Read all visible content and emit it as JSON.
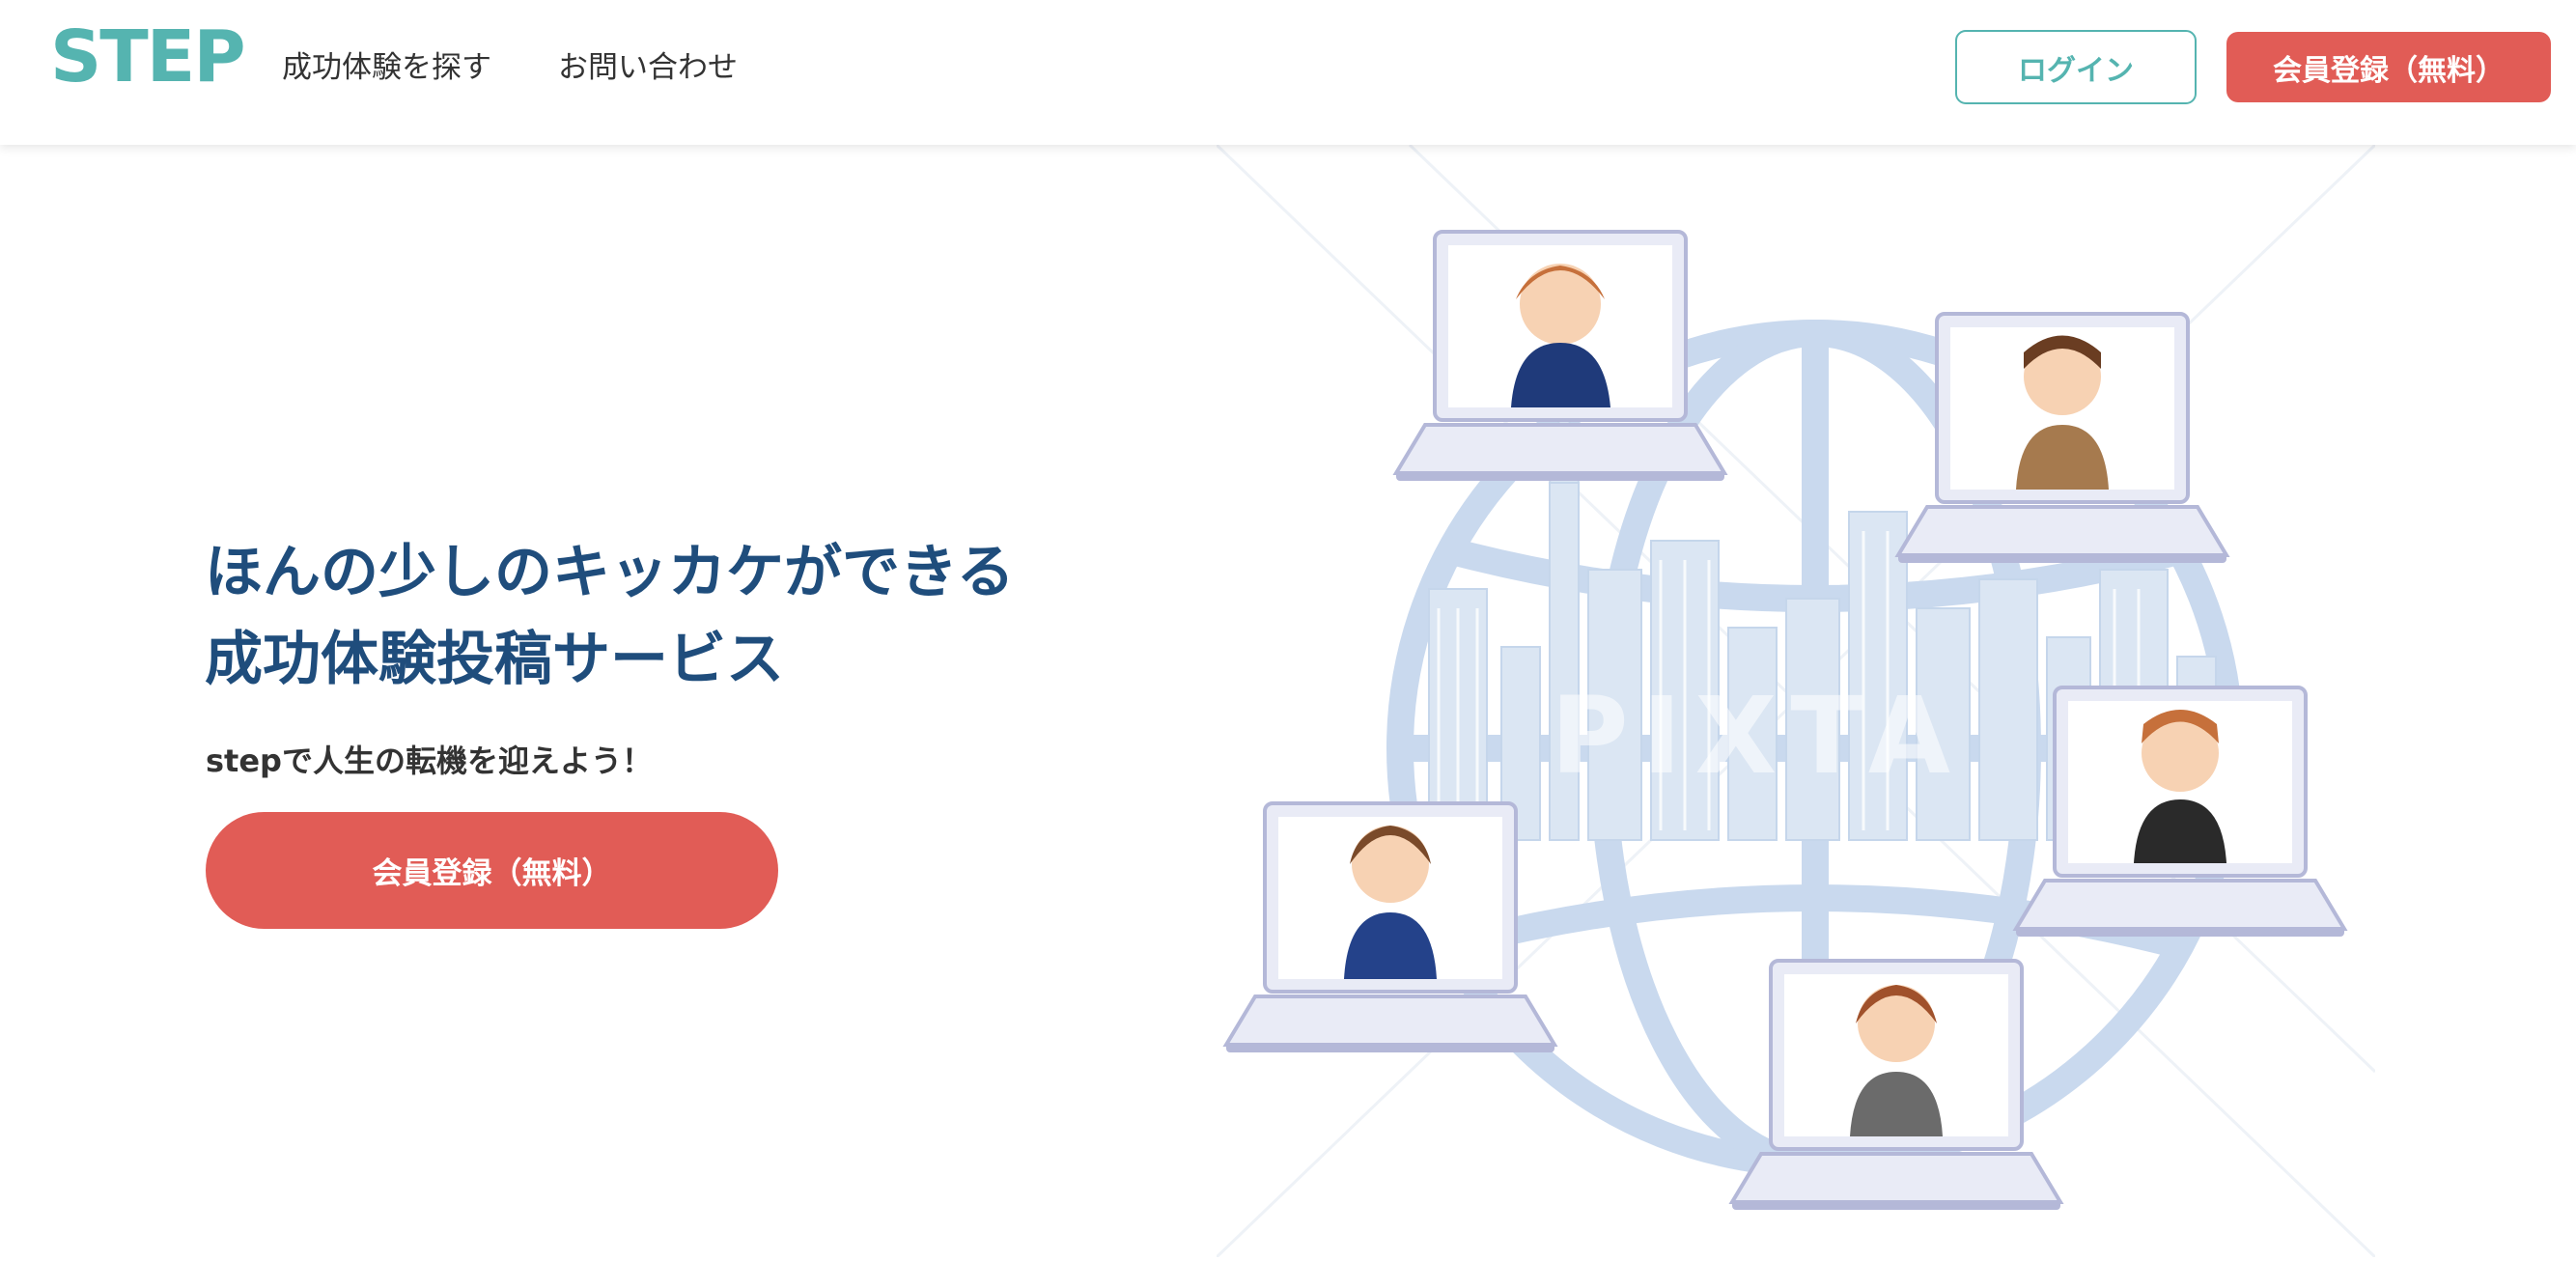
{
  "header": {
    "logo": "STEP",
    "nav": {
      "find": "成功体験を探す",
      "contact": "お問い合わせ"
    },
    "login_label": "ログイン",
    "signup_label": "会員登録（無料）"
  },
  "hero": {
    "title_line1": "ほんの少しのキッカケができる",
    "title_line2": "成功体験投稿サービス",
    "subtitle": "stepで人生の転機を迎えよう！",
    "cta_label": "会員登録（無料）",
    "illustration": {
      "watermark": "PIXTA",
      "icon": "globe-laptops-people-illustration"
    }
  },
  "colors": {
    "accent_teal": "#55b4b0",
    "cta_red": "#e15c56",
    "title_navy": "#1f4d7c",
    "globe_blue": "#c9d9ee"
  }
}
